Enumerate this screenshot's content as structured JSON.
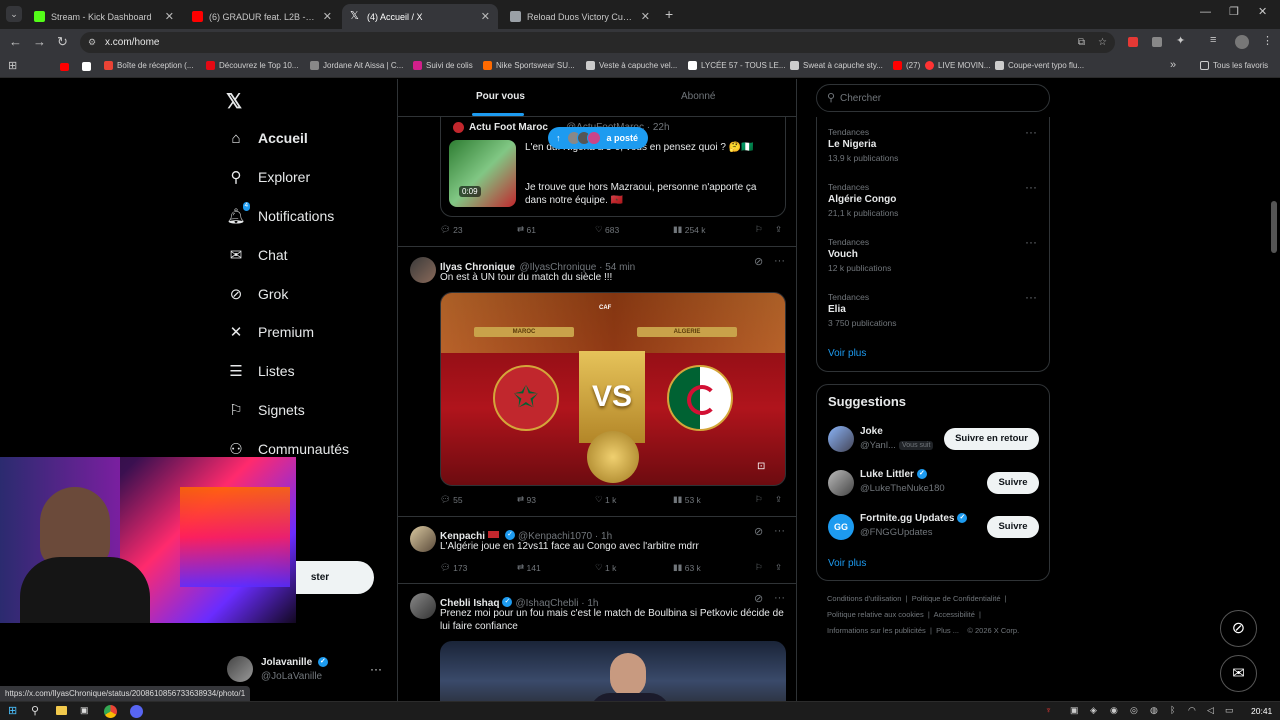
{
  "browser": {
    "tabs": [
      {
        "title": "Stream - Kick Dashboard",
        "color": "#53fc18"
      },
      {
        "title": "(6) GRADUR feat. L2B - CONGO",
        "color": "#ff0000"
      },
      {
        "title": "(4) Accueil / X",
        "color": "#ffffff"
      },
      {
        "title": "Reload Duos Victory Cup in Eu",
        "color": "#9aa0a6"
      }
    ],
    "url": "x.com/home",
    "bookmarks": [
      {
        "label": "Boîte de réception (...",
        "color": "#ea4335"
      },
      {
        "label": "Découvrez le Top 10...",
        "color": "#e50914"
      },
      {
        "label": "Jordane Ait Aissa | C...",
        "color": "#888888"
      },
      {
        "label": "Suivi de colis",
        "color": "#d01f8a"
      },
      {
        "label": "Nike Sportswear SU...",
        "color": "#ff6a00"
      },
      {
        "label": "Veste à capuche vel...",
        "color": "#cccccc"
      },
      {
        "label": "LYCÉE 57 - TOUS LE...",
        "color": "#ffffff"
      },
      {
        "label": "Sweat à capuche sty...",
        "color": "#cccccc"
      },
      {
        "label": "(27)",
        "color": "#ff0000"
      },
      {
        "label": "LIVE MOVIN...",
        "color": "#ff3333"
      },
      {
        "label": "Coupe-vent typo flu...",
        "color": "#cccccc"
      }
    ],
    "all_bookmarks": "Tous les favoris",
    "status_url": "https://x.com/IlyasChronique/status/2008610856733638934/photo/1"
  },
  "nav": {
    "items": [
      {
        "label": "Accueil",
        "icon": "home-icon"
      },
      {
        "label": "Explorer",
        "icon": "search-icon"
      },
      {
        "label": "Notifications",
        "icon": "bell-icon",
        "badge": "4"
      },
      {
        "label": "Chat",
        "icon": "mail-icon"
      },
      {
        "label": "Grok",
        "icon": "grok-icon"
      },
      {
        "label": "Premium",
        "icon": "x-icon"
      },
      {
        "label": "Listes",
        "icon": "list-icon"
      },
      {
        "label": "Signets",
        "icon": "bookmark-icon"
      },
      {
        "label": "Communautés",
        "icon": "people-icon"
      }
    ],
    "post_button": "ster",
    "account": {
      "name": "Jolavanille",
      "handle": "@JoLaVanille"
    }
  },
  "feed": {
    "tabs": [
      "Pour vous",
      "Abonné"
    ],
    "new_posts_pill": "a posté",
    "posts": [
      {
        "name": "Actu Foot Maroc",
        "handle": "@ActuFootMaroc",
        "time": "22h",
        "text1": "L'en                              du. Nigéria à 3-0, vous en pensez quoi ? 🤔🇳🇬",
        "text2": "Je trouve que hors Mazraoui, personne n'apporte ça dans notre équipe. 🇲🇦",
        "video_time": "0:09",
        "replies": "23",
        "reposts": "61",
        "likes": "683",
        "views": "254 k"
      },
      {
        "name": "Ilyas Chronique",
        "handle": "@IlyasChronique",
        "time": "54 min",
        "text": "On est à UN tour du match du siècle !!!",
        "image": {
          "left": "MAROC",
          "right": "ALGERIE",
          "center": "VS",
          "logo": "CAF"
        },
        "replies": "55",
        "reposts": "93",
        "likes": "1 k",
        "views": "53 k"
      },
      {
        "name": "Kenpachi",
        "handle": "@Kenpachi1070",
        "time": "1h",
        "text": "L'Algérie joue en 12vs11 face au Congo avec l'arbitre mdrr",
        "replies": "173",
        "reposts": "141",
        "likes": "1 k",
        "views": "63 k"
      },
      {
        "name": "Chebli Ishaq",
        "handle": "@IshaqChebli",
        "time": "1h",
        "text": "Prenez moi pour un fou mais c'est le match de Boulbina si Petkovic décide de lui faire confiance"
      }
    ]
  },
  "sidebar": {
    "search_placeholder": "Chercher",
    "trends": [
      {
        "category": "Tendances",
        "name": "Le Nigeria",
        "count": "13,9 k publications"
      },
      {
        "category": "Tendances",
        "name": "Algérie Congo",
        "count": "21,1 k publications"
      },
      {
        "category": "Tendances",
        "name": "Vouch",
        "count": "12 k publications"
      },
      {
        "category": "Tendances",
        "name": "Elia",
        "count": "3 750 publications"
      }
    ],
    "show_more": "Voir plus",
    "suggestions_title": "Suggestions",
    "suggestions": [
      {
        "name": "Joke",
        "handle": "@Yanl...",
        "follows_you": "Vous suit",
        "button": "Suivre en retour"
      },
      {
        "name": "Luke Littler",
        "handle": "@LukeTheNuke180",
        "button": "Suivre"
      },
      {
        "name": "Fortnite.gg Updates",
        "handle": "@FNGGUpdates",
        "button": "Suivre"
      }
    ],
    "suggestions_more": "Voir plus",
    "footer": {
      "l1": "Conditions d'utilisation",
      "l2": "Politique de Confidentialité",
      "l3": "Politique relative aux cookies",
      "l4": "Accessibilité",
      "l5": "Informations sur les publicités",
      "l6": "Plus ...",
      "l7": "© 2026 X Corp."
    }
  },
  "taskbar": {
    "time": "20:41"
  }
}
